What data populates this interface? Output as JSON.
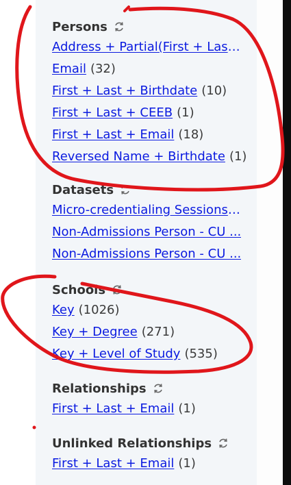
{
  "sections": [
    {
      "title": "Persons",
      "items": [
        {
          "label": "Address + Partial(First + Last...",
          "count": ""
        },
        {
          "label": "Email",
          "count": "(32)"
        },
        {
          "label": "First + Last + Birthdate",
          "count": "(10)"
        },
        {
          "label": "First + Last + CEEB",
          "count": "(1)"
        },
        {
          "label": "First + Last + Email",
          "count": "(18)"
        },
        {
          "label": "Reversed Name + Birthdate",
          "count": "(1)"
        }
      ]
    },
    {
      "title": "Datasets",
      "items": [
        {
          "label": "Micro-credentialing Sessions -...",
          "count": ""
        },
        {
          "label": "Non-Admissions Person - CU ...",
          "count": ""
        },
        {
          "label": "Non-Admissions Person - CU ...",
          "count": ""
        }
      ]
    },
    {
      "title": "Schools",
      "items": [
        {
          "label": "Key",
          "count": "(1026)"
        },
        {
          "label": "Key + Degree",
          "count": "(271)"
        },
        {
          "label": "Key + Level of Study",
          "count": "(535)"
        }
      ]
    },
    {
      "title": "Relationships",
      "items": [
        {
          "label": "First + Last + Email",
          "count": "(1)"
        }
      ]
    },
    {
      "title": "Unlinked Relationships",
      "items": [
        {
          "label": "First + Last + Email",
          "count": "(1)"
        }
      ]
    }
  ],
  "icons": {
    "refresh": "refresh-icon"
  },
  "colors": {
    "link": "#0a1ae0",
    "heading": "#333333",
    "panel_bg": "#f3f6f9",
    "annotation": "#e0161b"
  }
}
